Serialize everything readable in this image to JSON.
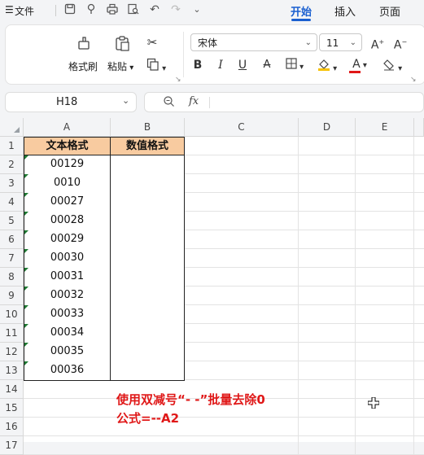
{
  "menubar": {
    "menu_icon": "☰",
    "file_label": "文件",
    "tabs": [
      {
        "label": "开始",
        "active": true
      },
      {
        "label": "插入",
        "active": false
      },
      {
        "label": "页面",
        "active": false
      }
    ]
  },
  "ribbon": {
    "format_painter": "格式刷",
    "paste": "粘贴",
    "font_name": "宋体",
    "font_size": "11"
  },
  "formula_bar": {
    "name_box": "H18",
    "fx": "fx",
    "formula": ""
  },
  "sheet": {
    "columns": [
      "A",
      "B",
      "C",
      "D",
      "E"
    ],
    "rows": [
      "1",
      "2",
      "3",
      "4",
      "5",
      "6",
      "7",
      "8",
      "9",
      "10",
      "11",
      "12",
      "13",
      "14",
      "15",
      "16",
      "17"
    ],
    "header_a": "文本格式",
    "header_b": "数值格式",
    "values_a": [
      "00129",
      "0010",
      "00027",
      "00028",
      "00029",
      "00030",
      "00031",
      "00032",
      "00033",
      "00034",
      "00035",
      "00036"
    ],
    "header_fill": "#f8cba0"
  },
  "annotation": {
    "line1": "使用双减号“- -”批量去除0",
    "line2": "公式=--A2",
    "color": "#e01818"
  }
}
